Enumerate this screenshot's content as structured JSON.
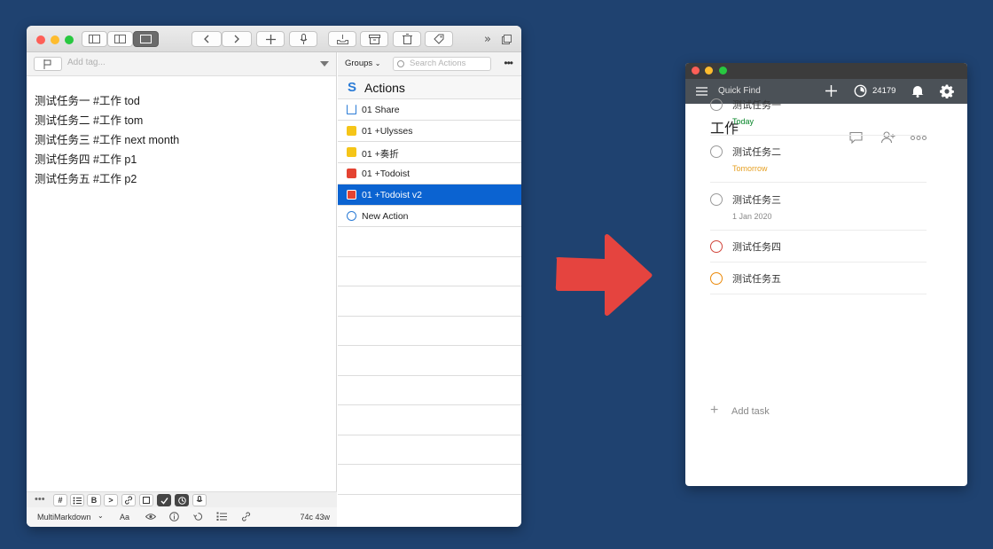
{
  "drafts": {
    "toolbar": {
      "forward_label": "»"
    },
    "tag_placeholder": "Add tag...",
    "lines": [
      "测试任务一 #工作 tod",
      "测试任务二 #工作 tom",
      "测试任务三 #工作 next month",
      "测试任务四 #工作 p1",
      "测试任务五 #工作 p2"
    ],
    "keyboard_keys": [
      "#",
      "B",
      ">"
    ],
    "status": {
      "syntax": "MultiMarkdown",
      "font_label": "Aa",
      "count": "74c 43w"
    },
    "actions_pane": {
      "groups_label": "Groups",
      "search_placeholder": "Search Actions",
      "header": "Actions",
      "rows": [
        {
          "label": "01 Share",
          "icon": "share-icon",
          "color": "#2a7bd6"
        },
        {
          "label": "01 +Ulysses",
          "icon": "document-icon",
          "color": "#f5c518"
        },
        {
          "label": "01 +奏折",
          "icon": "document-icon",
          "color": "#f5c518"
        },
        {
          "label": "01 +Todoist",
          "icon": "todoist-icon",
          "color": "#e44332"
        },
        {
          "label": "01 +Todoist v2",
          "icon": "todoist-icon",
          "color": "#e44332",
          "selected": true
        },
        {
          "label": "New Action",
          "icon": "circle-icon",
          "color": "#2a7bd6"
        }
      ]
    }
  },
  "todoist": {
    "quick_find": "Quick Find",
    "karma": "24179",
    "project_title": "工作",
    "tasks": [
      {
        "name": "测试任务一",
        "due": "Today",
        "due_color": "#058527",
        "priority_color": "#9a9a9a"
      },
      {
        "name": "测试任务二",
        "due": "Tomorrow",
        "due_color": "#e6a023",
        "priority_color": "#9a9a9a"
      },
      {
        "name": "测试任务三",
        "due": "1 Jan 2020",
        "due_color": "#888888",
        "priority_color": "#9a9a9a"
      },
      {
        "name": "测试任务四",
        "due": "",
        "due_color": "",
        "priority_color": "#d1453b"
      },
      {
        "name": "测试任务五",
        "due": "",
        "due_color": "",
        "priority_color": "#eb8909"
      }
    ],
    "add_task": "Add task"
  },
  "colors": {
    "background": "#1f4270",
    "arrow": "#e5443f",
    "selection": "#0b63d1"
  }
}
